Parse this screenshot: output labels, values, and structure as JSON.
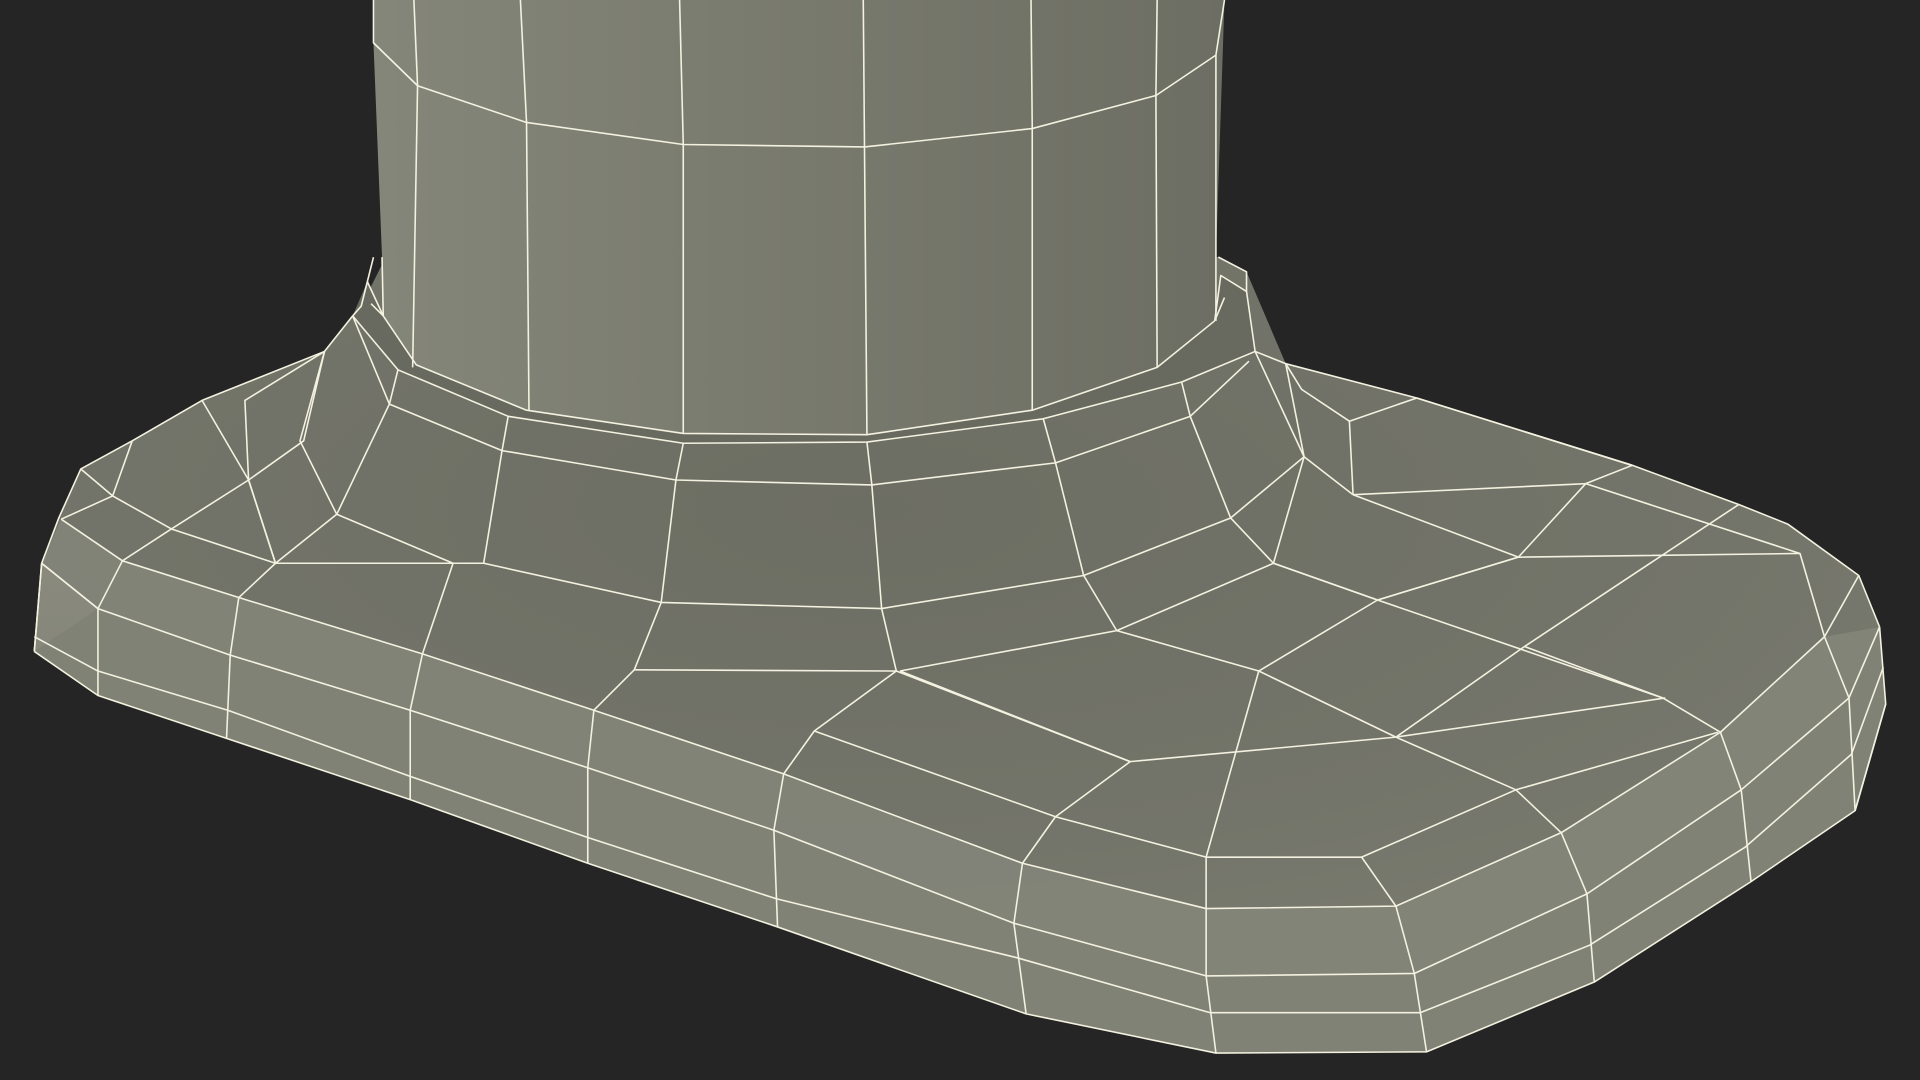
{
  "scene": {
    "description_visible_text": "",
    "colors": {
      "background": "#252525",
      "mesh_light": "#8a8b7e",
      "mesh_mid": "#77786c",
      "mesh_dark": "#5e5f55",
      "wire": "#f3f1df"
    },
    "icons": {
      "model": "wireframe-mesh-icon"
    }
  }
}
